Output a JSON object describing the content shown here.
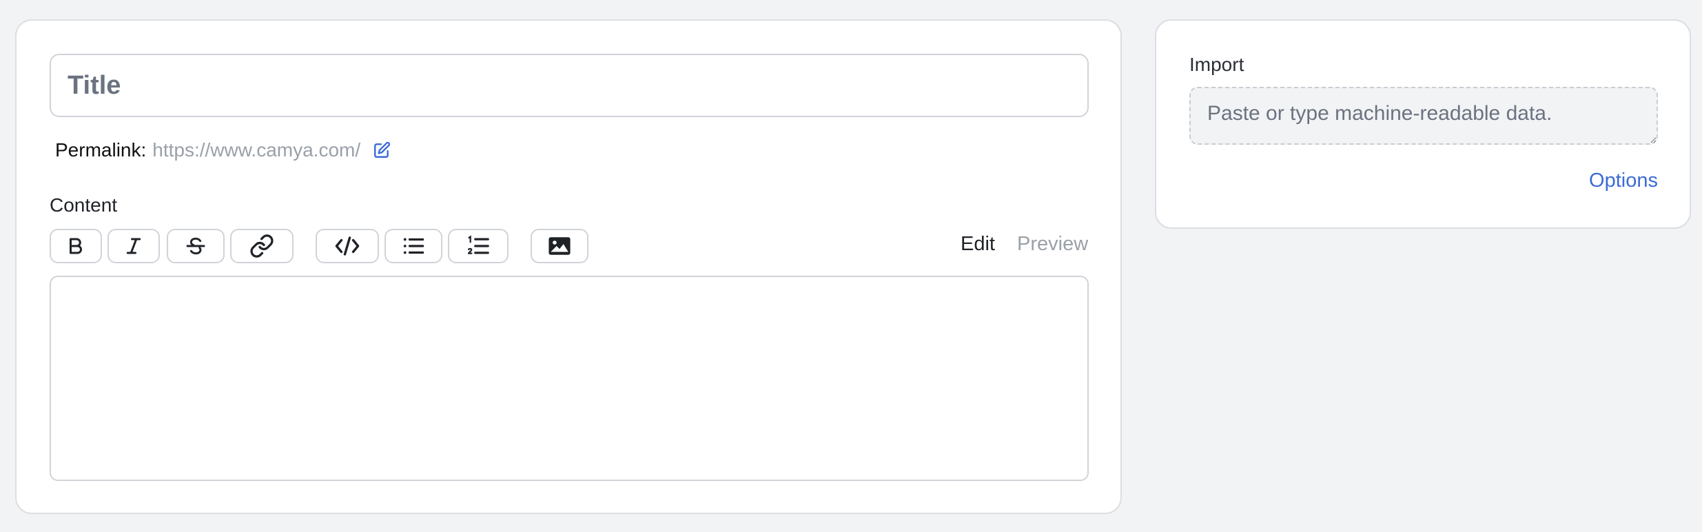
{
  "editor": {
    "title_placeholder": "Title",
    "permalink_label": "Permalink:",
    "permalink_url": "https://www.camya.com/",
    "content_label": "Content",
    "toolbar": {
      "bold": "bold-icon",
      "italic": "italic-icon",
      "strike": "strikethrough-icon",
      "link": "link-icon",
      "code": "code-icon",
      "bullet_list": "bullet-list-icon",
      "numbered_list": "numbered-list-icon",
      "image": "image-icon"
    },
    "tabs": {
      "edit": "Edit",
      "preview": "Preview"
    },
    "content_value": ""
  },
  "import": {
    "label": "Import",
    "placeholder": "Paste or type machine-readable data.",
    "options_label": "Options"
  },
  "colors": {
    "background": "#f2f3f5",
    "accent": "#3b6bd6",
    "muted_text": "#9aa0a8",
    "border": "#d0d3d8"
  }
}
